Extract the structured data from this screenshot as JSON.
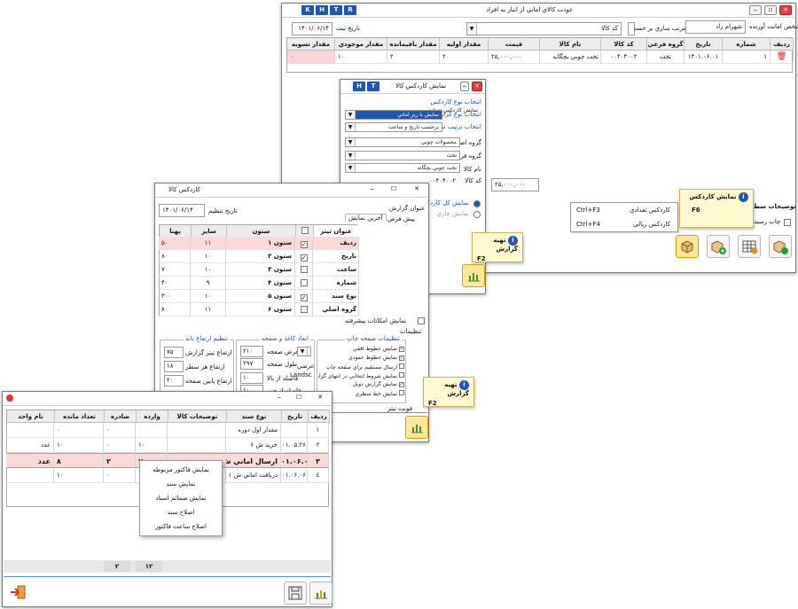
{
  "main": {
    "title": "عودت کالاي اماني از انبار به افراد",
    "tags": [
      "K",
      "H",
      "T",
      "R"
    ],
    "sort_label": "مرتب سازي بر حسب",
    "sort_value": "کد کالا",
    "owner_label": "شخص امانت آورنده",
    "owner_value": "شهرام راد",
    "date_label": "تاريخ ثبت",
    "date_value": "۱۴۰۱/۰۶/۱۴",
    "columns": [
      "رديف",
      "شماره",
      "تاريخ",
      "گروه فرعي",
      "کد کالا",
      "نام کالا",
      "قيمت",
      "مقدار اوليه",
      "مقدار باقيمانده",
      "مقدار موجودي",
      "مقدار تسويه"
    ],
    "row": [
      "",
      "۱",
      "۱۴۰۱.۰۶.۰۱",
      "تخت",
      "۰۰۴۰۴۰۰۲",
      "تخت چوبي بچگانه",
      "۲۵,۰۰۰,۰۰۰",
      "۲",
      "۲",
      "۱۰",
      "۰"
    ],
    "total_value": "۲۵,۰۰۰,۰۰۰",
    "desc_label": "توضيحات سطر",
    "print_label": "چاپ رسيد",
    "shortcuts": [
      {
        "label": "کاردکس تعدادي",
        "key": "Ctrl+F3"
      },
      {
        "label": "کاردکس ريالي",
        "key": "Ctrl+F4"
      }
    ],
    "tip_title": "نمايش کاردکس",
    "tip_key": "F6"
  },
  "settings": {
    "title": "نمايش کاردکس کالا",
    "tags": [
      "H",
      "T"
    ],
    "kardex_type_label": "انتخاب نوع کاردکس",
    "kardex_type_value": "نمايش کاردکس تعدادي",
    "report_type_label": "انتخاب نوع گزارش",
    "report_type_value": "نمايش با ريز اماني",
    "order_label": "انتخاب ترتيب نمايش",
    "order_value": "برحسب تاريخ و ساعت",
    "main_group_label": "گروه اصلي",
    "main_group_value": "محصولات چوبي",
    "sub_group_label": "گروه فرعي",
    "sub_group_value": "تخت",
    "item_name_label": "نام کالا",
    "item_name_value": "تخت چوبي بچگانه",
    "item_code_label": "کد کالا",
    "item_code_value": "۰۰۴۰۴۰۰۲",
    "show_all_label": "نمايش کل کاردکس",
    "show_current_label": "نمايش جاري",
    "tip_title": "تهيه گزارش",
    "tip_key": "F2"
  },
  "kardex_settings": {
    "title": "کاردکس کالا",
    "date_label": "تاريخ تنظيم",
    "date_value": "۱۴۰۱/۰۶/۱۴",
    "report_title_label": "عنوان گزارش",
    "tabs": [
      "پيش فرض",
      "آخرين نمايش"
    ],
    "columns": [
      "عنوان تيتر",
      "",
      "ستون",
      "سايز",
      "پهنا"
    ],
    "rows": [
      {
        "title": "رديف",
        "checked": true,
        "col": "ستون ۱",
        "size": "۱۱",
        "width": "۵۰"
      },
      {
        "title": "تاريخ",
        "checked": true,
        "col": "ستون ۲",
        "size": "۱۰",
        "width": "۸۰"
      },
      {
        "title": "ساعت",
        "checked": false,
        "col": "ستون ۳",
        "size": "۱۰",
        "width": "۷۰"
      },
      {
        "title": "شماره",
        "checked": false,
        "col": "ستون ۴",
        "size": "۹",
        "width": "۴۰"
      },
      {
        "title": "نوع سند",
        "checked": true,
        "col": "ستون ۵",
        "size": "۱۰",
        "width": "۳۰۰"
      },
      {
        "title": "گروه اصلي",
        "checked": false,
        "col": "ستون ۶",
        "size": "۱۱",
        "width": "۸۰"
      }
    ],
    "advanced_label": "نمايش امکانات پيشرفته",
    "settings_label": "تنظيمات",
    "print_group": "تنظيمات صفحه چاپ",
    "print_opts": [
      "نمايش خطوط افقي",
      "نمايش خطوط عمودي",
      "ارسال مستقيم براي صفحه چاپ",
      "نمايش شروط انتخابي در انتهاي گزارش",
      "نمايش گزارش دوبل",
      "نمايش خط سطري"
    ],
    "dims_group": "ابعاد کاغذ و صفحه",
    "page_width_label": "عرض صفحه",
    "page_width": "۲۱۰",
    "page_height_label": "طول صفحه",
    "page_height": "۲۹۷",
    "top_margin_label": "فاصله از بالا",
    "top_margin": "۱۰",
    "left_margin_label": "فاصله از چپ",
    "left_margin": "۱۰",
    "orientation": "Landsc",
    "orientation_label": "عرضي",
    "row_height_group": "تنظيم ارتفاع باند",
    "title_height_label": "ارتفاع تيتر گزارش",
    "title_height": "۷۵",
    "row_h_label": "ارتفاع هر سطر",
    "row_h": "۱۸",
    "footer_h_label": "ارتفاع پايين صفحه",
    "footer_h": "۲۰",
    "font_label": "فونت تيتر",
    "tip_title": "تهيه گزارش",
    "tip_key": "F2"
  },
  "report": {
    "columns": [
      "رديف",
      "تاريخ",
      "نوع سند",
      "توضيحات کالا",
      "وارده",
      "صادره",
      "تعداد مانده",
      "نام واحد"
    ],
    "rows": [
      {
        "idx": "۱",
        "date": "",
        "type": "مقدار اول دوره",
        "desc": "",
        "in": "",
        "out": "۰",
        "rem": "۰",
        "unit": ""
      },
      {
        "idx": "۲",
        "date": "۰۱.۰۵.۲۶",
        "type": "خريد ش ۶",
        "desc": "",
        "in": "۱۰",
        "out": "۰",
        "rem": "۱۰",
        "unit": "عدد"
      },
      {
        "idx": "۳",
        "date": "۰۱.۰۶.۰۶",
        "type": "ارسال اماني ش ۱",
        "desc": "",
        "in": "۲",
        "out": "۲",
        "rem": "۸",
        "unit": "عدد"
      },
      {
        "idx": "٤",
        "date": "۰۱.۰۶.۰۶",
        "type": "دريافت اماني ش ۱",
        "desc": "",
        "in": "",
        "out": "۰",
        "rem": "۱۰",
        "unit": ""
      }
    ],
    "context_menu": [
      "نمايش فاکتور مربوطه",
      "نمايش سند",
      "نمايش ضمائم اسناد",
      "اصلاح سند",
      "اصلاح ساعت فاکتور"
    ],
    "total_in": "۱۲",
    "total_out": "۲"
  }
}
